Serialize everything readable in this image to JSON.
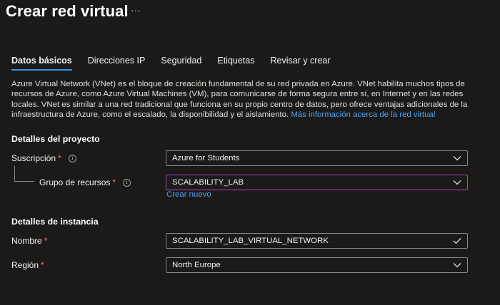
{
  "page": {
    "title": "Crear red virtual",
    "more_label": "···"
  },
  "tabs": [
    {
      "label": "Datos básicos",
      "active": true
    },
    {
      "label": "Direcciones IP",
      "active": false
    },
    {
      "label": "Seguridad",
      "active": false
    },
    {
      "label": "Etiquetas",
      "active": false
    },
    {
      "label": "Revisar y crear",
      "active": false
    }
  ],
  "description": {
    "text": "Azure Virtual Network (VNet) es el bloque de creación fundamental de su red privada en Azure. VNet habilita muchos tipos de recursos de Azure, como Azure Virtual Machines (VM), para comunicarse de forma segura entre sí, en Internet y en las redes locales. VNet es similar a una red tradicional que funciona en su propio centro de datos, pero ofrece ventajas adicionales de la infraestructura de Azure, como el escalado, la disponibilidad y el aislamiento.",
    "link": "Más información acerca de la red virtual"
  },
  "project": {
    "heading": "Detalles del proyecto",
    "subscription": {
      "label": "Suscripción",
      "required": "*",
      "value": "Azure for Students"
    },
    "resource_group": {
      "label": "Grupo de recursos",
      "required": "*",
      "value": "SCALABILITY_LAB",
      "create_new": "Crear nuevo"
    }
  },
  "instance": {
    "heading": "Detalles de instancia",
    "name": {
      "label": "Nombre",
      "required": "*",
      "value": "SCALABILITY_LAB_VIRTUAL_NETWORK"
    },
    "region": {
      "label": "Región",
      "required": "*",
      "value": "North Europe"
    }
  },
  "icons": {
    "info": "info-icon",
    "dropdown": "chevron-down-icon",
    "valid": "checkmark-icon",
    "more": "ellipsis-icon"
  },
  "colors": {
    "background": "#1b1a19",
    "accent": "#2899f5",
    "link": "#4fa1f5",
    "required": "#f1707b",
    "focus_border": "#a34bba"
  }
}
